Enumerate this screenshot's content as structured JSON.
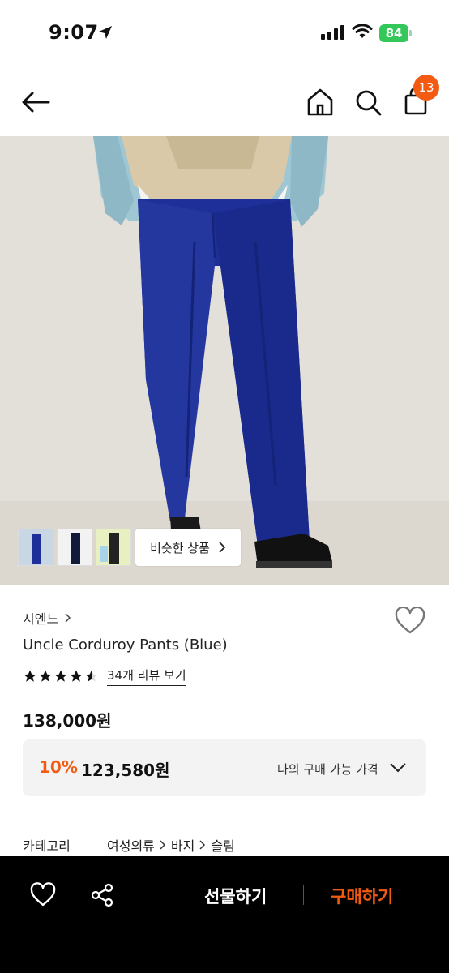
{
  "status_bar": {
    "time": "9:07",
    "battery": "84"
  },
  "nav": {
    "cart_count": "13"
  },
  "gallery": {
    "similar_label": "비슷한 상품"
  },
  "product": {
    "brand": "시엔느",
    "name": "Uncle Corduroy Pants (Blue)",
    "rating": 4.5,
    "review_link": "34개 리뷰 보기",
    "price": "138,000원",
    "discount": "10%",
    "final_price": "123,580원",
    "my_price_label": "나의 구매 가능 가격"
  },
  "category": {
    "label": "카테고리",
    "path": [
      "여성의류",
      "바지",
      "슬림"
    ]
  },
  "bottom_bar": {
    "gift_label": "선물하기",
    "buy_label": "구매하기"
  },
  "colors": {
    "accent": "#f35b13",
    "battery": "#34c759",
    "pants_blue": "#1e2f9a"
  }
}
